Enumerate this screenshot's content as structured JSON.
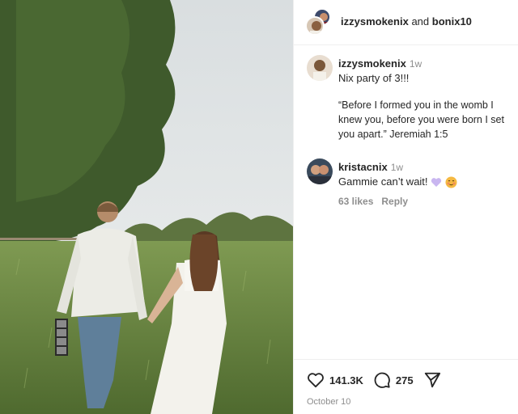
{
  "post": {
    "authors": {
      "user1": "izzysmokenix",
      "joiner": "and",
      "user2": "bonix10"
    },
    "caption": {
      "username": "izzysmokenix",
      "time": "1w",
      "text": "Nix party of 3!!!",
      "verse": "“Before I formed you in the womb I knew you, before you were born I set you apart.” Jeremiah 1:5"
    },
    "comments": [
      {
        "username": "kristacnix",
        "time": "1w",
        "text": "Gammie can’t wait!",
        "likes": "63 likes",
        "reply": "Reply",
        "emojis": [
          "purple-heart-icon",
          "smiling-blush-face-icon"
        ]
      }
    ],
    "stats": {
      "likes": "141.3K",
      "comments": "275"
    },
    "date": "October 10"
  },
  "colors": {
    "muted": "#8e8e8e",
    "text": "#262626",
    "heart_purple": "#c9b6f0",
    "emoji_yellow": "#f5b942"
  }
}
